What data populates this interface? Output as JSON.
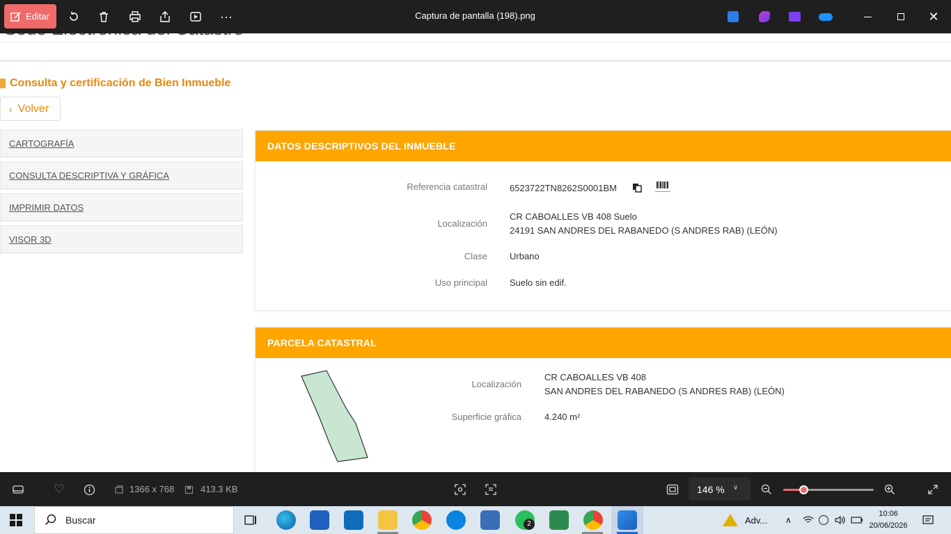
{
  "window": {
    "edit_label": "Editar",
    "title": "Captura de pantalla (198).png"
  },
  "page": {
    "cut_title": "Sede Electrónica del Catastro",
    "section_title": "Consulta y certificación de Bien Inmueble",
    "back_label": "Volver",
    "sidebar": [
      {
        "label": "CARTOGRAFÍA"
      },
      {
        "label": "CONSULTA DESCRIPTIVA Y GRÁFICA"
      },
      {
        "label": "IMPRIMIR DATOS"
      },
      {
        "label": "VISOR 3D"
      }
    ],
    "datos": {
      "header": "DATOS DESCRIPTIVOS DEL INMUEBLE",
      "ref_label": "Referencia catastral",
      "ref_value": "6523722TN8262S0001BM",
      "loc_label": "Localización",
      "loc_line1": "CR CABOALLES VB 408 Suelo",
      "loc_line2": "24191 SAN ANDRES DEL RABANEDO (S ANDRES RAB) (LEÓN)",
      "clase_label": "Clase",
      "clase_value": "Urbano",
      "uso_label": "Uso principal",
      "uso_value": "Suelo sin edif."
    },
    "parcela": {
      "header": "PARCELA CATASTRAL",
      "loc_label": "Localización",
      "loc_line1": "CR CABOALLES VB 408",
      "loc_line2": "SAN ANDRES DEL RABANEDO (S ANDRES RAB) (LEÓN)",
      "sup_label": "Superficie gráfica",
      "sup_value": "4.240 m²"
    }
  },
  "status": {
    "dimensions": "1366 x 768",
    "file_size": "413.3 KB",
    "zoom": "146 %",
    "zoom_level_percent": 23
  },
  "taskbar": {
    "search_placeholder": "Buscar",
    "tray_text": "Adv...",
    "badge": "2",
    "time": "10:06",
    "date": "20/06/2026"
  },
  "colors": {
    "accent_orange": "#fea500",
    "title_orange": "#e8870e",
    "edit_red": "#f06a6a",
    "parcel_fill": "#c8e6d2"
  }
}
